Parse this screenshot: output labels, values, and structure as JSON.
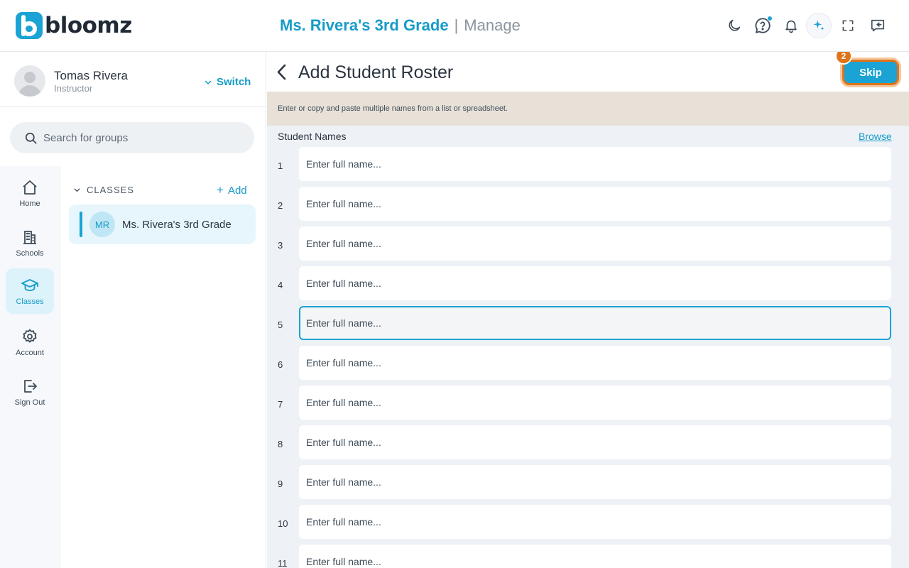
{
  "app": {
    "logo_text": "bloomz"
  },
  "header": {
    "class_name": "Ms. Rivera's 3rd Grade",
    "separator": "|",
    "section": "Manage",
    "icons": [
      "moon-icon",
      "help-icon",
      "bell-icon",
      "sparkle-icon",
      "fullscreen-icon",
      "feedback-icon"
    ],
    "help_has_notification": true
  },
  "profile": {
    "name": "Tomas Rivera",
    "role": "Instructor",
    "switch_label": "Switch"
  },
  "search": {
    "placeholder": "Search for groups"
  },
  "nav": [
    {
      "label": "Home",
      "icon": "home-icon",
      "active": false
    },
    {
      "label": "Schools",
      "icon": "building-icon",
      "active": false
    },
    {
      "label": "Classes",
      "icon": "graduation-cap-icon",
      "active": true
    },
    {
      "label": "Account",
      "icon": "gear-icon",
      "active": false
    },
    {
      "label": "Sign Out",
      "icon": "sign-out-icon",
      "active": false
    }
  ],
  "groups": {
    "section_label": "CLASSES",
    "add_label": "Add",
    "add_symbol": "+",
    "items": [
      {
        "initials": "MR",
        "name": "Ms. Rivera's 3rd Grade"
      }
    ]
  },
  "page": {
    "title": "Add Student Roster",
    "skip_label": "Skip",
    "step_badge": "2",
    "instruction": "Enter or copy and paste multiple names from a list or spreadsheet.",
    "list_label": "Student Names",
    "browse_label": "Browse",
    "name_placeholder": "Enter full name...",
    "focused_row": 5,
    "rows": [
      "1",
      "2",
      "3",
      "4",
      "5",
      "6",
      "7",
      "8",
      "9",
      "10",
      "11"
    ]
  },
  "colors": {
    "brand": "#1aa3d4",
    "highlight": "#e07318",
    "instruction_bg": "#e8e1d8",
    "main_bg": "#eef2f7"
  }
}
